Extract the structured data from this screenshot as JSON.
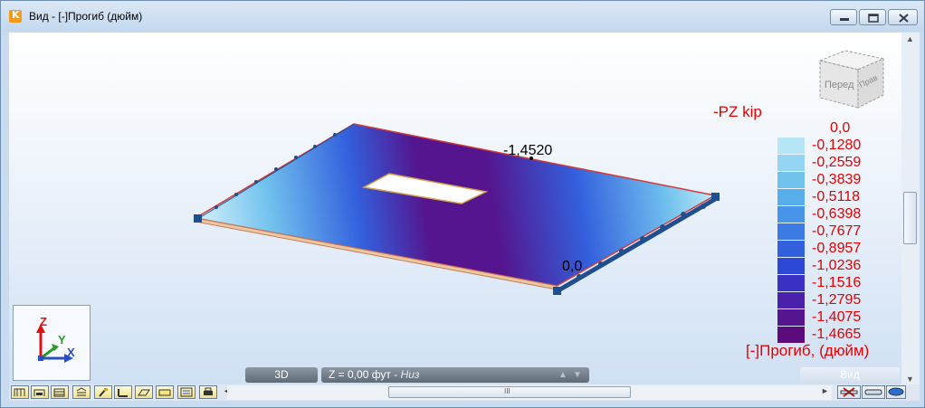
{
  "window": {
    "title": "Вид - [-]Прогиб (дюйм)"
  },
  "plot": {
    "max_label": "-1,4520",
    "zero_label": "0,0"
  },
  "legend": {
    "title": "-PZ kip",
    "caption": "[-]Прогиб, (дюйм)",
    "text_color": "#e60000",
    "values": [
      "0,0",
      "-0,1280",
      "-0,2559",
      "-0,3839",
      "-0,5118",
      "-0,6398",
      "-0,7677",
      "-0,8957",
      "-1,0236",
      "-1,1516",
      "-1,2795",
      "-1,4075",
      "-1,4665"
    ],
    "colors": [
      "#d9f3fb",
      "#b6e6f7",
      "#93d5f2",
      "#72c2ee",
      "#58adeb",
      "#4794e8",
      "#3b79e3",
      "#3360dd",
      "#2e48d6",
      "#3a30c4",
      "#4a21aa",
      "#54158e",
      "#5b0b7a"
    ]
  },
  "view_cube": {
    "front_label": "Перед",
    "right_label": "Прав"
  },
  "axes_indicator": {
    "z": "Z",
    "y": "Y",
    "x": "X"
  },
  "status": {
    "view_mode": "3D",
    "plane_text": "Z = 0,00 фут - ",
    "plane_side": "Низ",
    "view_button": "Вид"
  },
  "scrollbar": {
    "grip": "III"
  },
  "icons": {
    "toolbar": [
      "grid-icon",
      "slab-icon",
      "wall-icon",
      "foundation-icon",
      "brush-icon",
      "beam-icon",
      "plate-icon",
      "panel-icon",
      "numbers-icon",
      "print-icon"
    ],
    "right": [
      "delete-icon",
      "pipe-icon",
      "view-icon"
    ]
  }
}
